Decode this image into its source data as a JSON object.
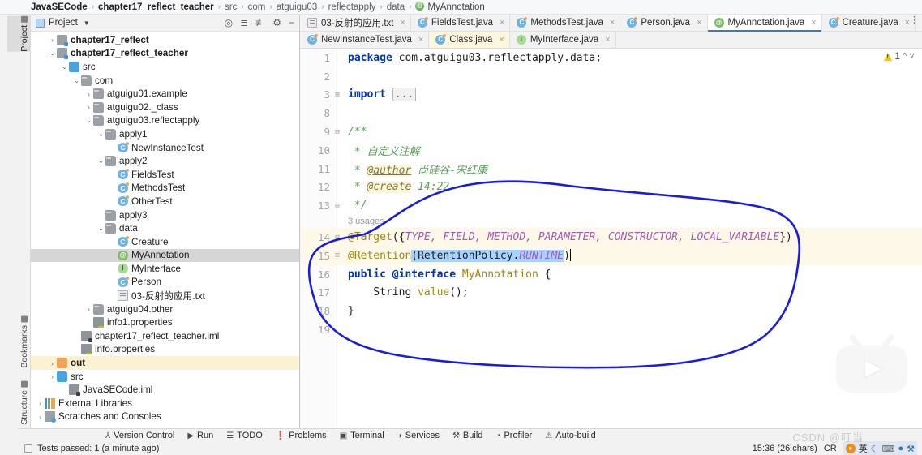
{
  "breadcrumb": {
    "items": [
      {
        "label": "JavaSECode",
        "style": "bold"
      },
      {
        "label": "chapter17_reflect_teacher",
        "style": "bold"
      },
      {
        "label": "src",
        "style": "dim"
      },
      {
        "label": "com",
        "style": "dim"
      },
      {
        "label": "atguigu03",
        "style": "dim"
      },
      {
        "label": "reflectapply",
        "style": "dim"
      },
      {
        "label": "data",
        "style": "dim"
      },
      {
        "label": "MyAnnotation",
        "style": "icon"
      }
    ]
  },
  "left_strip": {
    "items": [
      {
        "label": "Project",
        "selected": true
      },
      {
        "label": "Bookmarks",
        "selected": false
      },
      {
        "label": "Structure",
        "selected": false
      }
    ]
  },
  "project_panel": {
    "title": "Project",
    "toolbar_icons": [
      "locate-icon",
      "expand-all-icon",
      "collapse-all-icon",
      "settings-gear-icon",
      "minimize-icon"
    ],
    "tree": [
      {
        "label": "chapter17_reflect",
        "indent": 1,
        "arrow": "collapsed",
        "icon": "module-icon",
        "bold": true,
        "state": "none"
      },
      {
        "label": "chapter17_reflect_teacher",
        "indent": 1,
        "arrow": "expanded",
        "icon": "module-icon",
        "bold": true,
        "state": "none"
      },
      {
        "label": "src",
        "indent": 2,
        "arrow": "expanded",
        "icon": "folder-blue-icon",
        "bold": false,
        "state": "none"
      },
      {
        "label": "com",
        "indent": 3,
        "arrow": "expanded",
        "icon": "folder-gray-icon",
        "bold": false,
        "state": "none"
      },
      {
        "label": "atguigu01.example",
        "indent": 4,
        "arrow": "collapsed",
        "icon": "folder-gray-icon",
        "bold": false,
        "state": "none"
      },
      {
        "label": "atguigu02._class",
        "indent": 4,
        "arrow": "collapsed",
        "icon": "folder-gray-icon",
        "bold": false,
        "state": "none"
      },
      {
        "label": "atguigu03.reflectapply",
        "indent": 4,
        "arrow": "expanded",
        "icon": "folder-gray-icon",
        "bold": false,
        "state": "none"
      },
      {
        "label": "apply1",
        "indent": 5,
        "arrow": "expanded",
        "icon": "folder-gray-icon",
        "bold": false,
        "state": "none"
      },
      {
        "label": "NewInstanceTest",
        "indent": 6,
        "arrow": "none",
        "icon": "java-class-icon",
        "bold": false,
        "state": "none"
      },
      {
        "label": "apply2",
        "indent": 5,
        "arrow": "expanded",
        "icon": "folder-gray-icon",
        "bold": false,
        "state": "none"
      },
      {
        "label": "FieldsTest",
        "indent": 6,
        "arrow": "none",
        "icon": "java-class-icon",
        "bold": false,
        "state": "none"
      },
      {
        "label": "MethodsTest",
        "indent": 6,
        "arrow": "none",
        "icon": "java-class-icon",
        "bold": false,
        "state": "none"
      },
      {
        "label": "OtherTest",
        "indent": 6,
        "arrow": "none",
        "icon": "java-class-icon",
        "bold": false,
        "state": "none"
      },
      {
        "label": "apply3",
        "indent": 5,
        "arrow": "none",
        "icon": "folder-gray-icon",
        "bold": false,
        "state": "none"
      },
      {
        "label": "data",
        "indent": 5,
        "arrow": "expanded",
        "icon": "folder-gray-icon",
        "bold": false,
        "state": "none"
      },
      {
        "label": "Creature",
        "indent": 6,
        "arrow": "none",
        "icon": "java-class-icon",
        "bold": false,
        "state": "none"
      },
      {
        "label": "MyAnnotation",
        "indent": 6,
        "arrow": "none",
        "icon": "annotation-icon",
        "bold": false,
        "state": "selected"
      },
      {
        "label": "MyInterface",
        "indent": 6,
        "arrow": "none",
        "icon": "interface-icon",
        "bold": false,
        "state": "none"
      },
      {
        "label": "Person",
        "indent": 6,
        "arrow": "none",
        "icon": "java-class-icon",
        "bold": false,
        "state": "none"
      },
      {
        "label": "03-反射的应用.txt",
        "indent": 6,
        "arrow": "none",
        "icon": "text-file-icon",
        "bold": false,
        "state": "none"
      },
      {
        "label": "atguigu04.other",
        "indent": 4,
        "arrow": "collapsed",
        "icon": "folder-gray-icon",
        "bold": false,
        "state": "none"
      },
      {
        "label": "info1.properties",
        "indent": 4,
        "arrow": "none",
        "icon": "properties-icon",
        "bold": false,
        "state": "none"
      },
      {
        "label": "chapter17_reflect_teacher.iml",
        "indent": 3,
        "arrow": "none",
        "icon": "iml-file-icon",
        "bold": false,
        "state": "none"
      },
      {
        "label": "info.properties",
        "indent": 3,
        "arrow": "none",
        "icon": "properties-icon",
        "bold": false,
        "state": "none"
      },
      {
        "label": "out",
        "indent": 1,
        "arrow": "collapsed",
        "icon": "folder-orange-icon",
        "bold": true,
        "state": "highlight"
      },
      {
        "label": "src",
        "indent": 1,
        "arrow": "collapsed",
        "icon": "folder-blue-icon",
        "bold": false,
        "state": "none"
      },
      {
        "label": "JavaSECode.iml",
        "indent": 2,
        "arrow": "none",
        "icon": "iml-file-icon",
        "bold": false,
        "state": "none"
      },
      {
        "label": "External Libraries",
        "indent": 0,
        "arrow": "collapsed",
        "icon": "library-icon",
        "bold": false,
        "state": "none"
      },
      {
        "label": "Scratches and Consoles",
        "indent": 0,
        "arrow": "collapsed",
        "icon": "scratches-icon",
        "bold": false,
        "state": "none"
      }
    ]
  },
  "editor": {
    "tabs_row1": [
      {
        "label": "03-反射的应用.txt",
        "icon": "text-file-icon",
        "active": false,
        "cream": false
      },
      {
        "label": "FieldsTest.java",
        "icon": "java-class-icon",
        "active": false,
        "cream": false
      },
      {
        "label": "MethodsTest.java",
        "icon": "java-class-icon",
        "active": false,
        "cream": false
      },
      {
        "label": "Person.java",
        "icon": "java-class-icon",
        "active": false,
        "cream": false
      },
      {
        "label": "MyAnnotation.java",
        "icon": "annotation-icon",
        "active": true,
        "cream": false
      },
      {
        "label": "Creature.java",
        "icon": "java-class-icon",
        "active": false,
        "cream": false
      }
    ],
    "tabs_row2": [
      {
        "label": "NewInstanceTest.java",
        "icon": "java-class-icon",
        "active": false,
        "cream": false
      },
      {
        "label": "Class.java",
        "icon": "java-class-icon",
        "active": false,
        "cream": true
      },
      {
        "label": "MyInterface.java",
        "icon": "interface-icon",
        "active": false,
        "cream": false
      }
    ],
    "warning_count": "1",
    "usages_label": "3 usages",
    "lines": [
      {
        "num": "1",
        "fold": "",
        "segments": [
          {
            "t": "package ",
            "c": "kw"
          },
          {
            "t": "com.atguigu03.reflectapply.data;",
            "c": "plain"
          }
        ]
      },
      {
        "num": "2",
        "fold": "",
        "segments": []
      },
      {
        "num": "3",
        "fold": "+",
        "segments": [
          {
            "t": "import ",
            "c": "kw"
          },
          {
            "t": "...",
            "c": "importbox"
          }
        ]
      },
      {
        "num": "8",
        "fold": "",
        "segments": []
      },
      {
        "num": "9",
        "fold": "-",
        "segments": [
          {
            "t": "/**",
            "c": "cmt-g"
          }
        ]
      },
      {
        "num": "10",
        "fold": "",
        "segments": [
          {
            "t": " * ",
            "c": "cmt-g"
          },
          {
            "t": "自定义注解",
            "c": "cmt-g"
          }
        ]
      },
      {
        "num": "11",
        "fold": "",
        "segments": [
          {
            "t": " * ",
            "c": "cmt-g"
          },
          {
            "t": "@author",
            "c": "tag"
          },
          {
            "t": " 尚硅谷-宋红康",
            "c": "cmt-g"
          }
        ]
      },
      {
        "num": "12",
        "fold": "",
        "segments": [
          {
            "t": " * ",
            "c": "cmt-g"
          },
          {
            "t": "@create",
            "c": "tag"
          },
          {
            "t": " 14:22",
            "c": "cmt-g"
          }
        ]
      },
      {
        "num": "13",
        "fold": "-",
        "segments": [
          {
            "t": " */",
            "c": "cmt-g"
          }
        ]
      },
      {
        "num": "14",
        "fold": "-",
        "segments": [
          {
            "t": "@Target",
            "c": "anno"
          },
          {
            "t": "({",
            "c": "plain"
          },
          {
            "t": "TYPE, FIELD, METHOD, PARAMETER, CONSTRUCTOR, LOCAL_VARIABLE",
            "c": "cnst"
          },
          {
            "t": "})",
            "c": "plain"
          }
        ],
        "highlight": true
      },
      {
        "num": "15",
        "fold": "-",
        "segments": [
          {
            "t": "@Retention",
            "c": "anno"
          },
          {
            "t": "(RetentionPolicy.",
            "c": "sel-plain"
          },
          {
            "t": "RUNTIME",
            "c": "sel-const"
          },
          {
            "t": ")",
            "c": "plain"
          },
          {
            "t": "|caret|",
            "c": "caret"
          }
        ],
        "highlight": true
      },
      {
        "num": "16",
        "fold": "",
        "segments": [
          {
            "t": "public ",
            "c": "kw"
          },
          {
            "t": "@interface ",
            "c": "kw"
          },
          {
            "t": "MyAnnotation",
            "c": "anno"
          },
          {
            "t": " {",
            "c": "plain"
          }
        ]
      },
      {
        "num": "17",
        "fold": "",
        "segments": [
          {
            "t": "    String ",
            "c": "plain"
          },
          {
            "t": "value",
            "c": "anno"
          },
          {
            "t": "();",
            "c": "plain"
          }
        ]
      },
      {
        "num": "18",
        "fold": "",
        "segments": [
          {
            "t": "}",
            "c": "plain"
          }
        ]
      },
      {
        "num": "19",
        "fold": "",
        "segments": []
      }
    ]
  },
  "tool_window_bar": {
    "items": [
      {
        "label": "Version Control",
        "icon": "branch-icon"
      },
      {
        "label": "Run",
        "icon": "play-icon"
      },
      {
        "label": "TODO",
        "icon": "list-icon"
      },
      {
        "label": "Problems",
        "icon": "error-icon"
      },
      {
        "label": "Terminal",
        "icon": "terminal-icon"
      },
      {
        "label": "Services",
        "icon": "services-icon"
      },
      {
        "label": "Build",
        "icon": "hammer-icon"
      },
      {
        "label": "Profiler",
        "icon": "profiler-icon"
      },
      {
        "label": "Auto-build",
        "icon": "warning-icon"
      }
    ]
  },
  "status_bar": {
    "message": "Tests passed: 1 (a minute ago)",
    "caret_position": "15:36 (26 chars)",
    "line_separator": "CR",
    "watermark": "CSDN @叮当",
    "ime_indicator": "英"
  }
}
